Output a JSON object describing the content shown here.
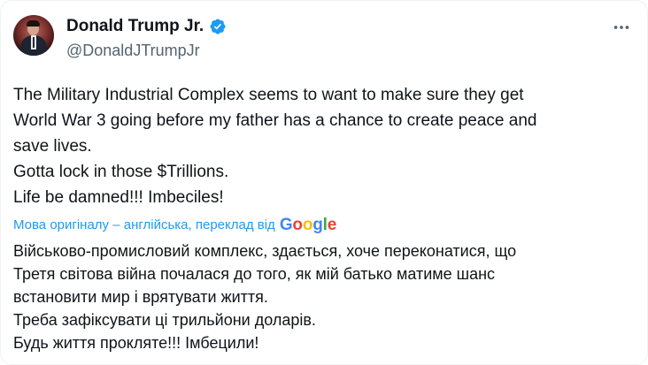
{
  "post": {
    "author": {
      "display_name": "Donald Trump Jr.",
      "handle": "@DonaldJTrumpJr",
      "verified": true
    },
    "original_text_lines": [
      "The Military Industrial Complex seems to want to make sure they get",
      "World War 3 going before my father has a chance to create peace and",
      "save lives.",
      "Gotta lock in those $Trillions.",
      "Life be damned!!! Imbeciles!"
    ],
    "translation": {
      "label": "Мова оригіналу – англійська, переклад від",
      "provider": "Google",
      "provider_letters": [
        "G",
        "o",
        "o",
        "g",
        "l",
        "e"
      ],
      "text_lines": [
        "Військово-промисловий комплекс, здається, хоче переконатися, що",
        "Третя світова війна почалася до того, як мій батько матиме шанс",
        "встановити мир і врятувати життя.",
        "Треба зафіксувати ці трильйони доларів.",
        "Будь життя прокляте!!! Імбецили!"
      ]
    }
  },
  "icons": {
    "avatar": "avatar",
    "verified": "verified-badge-icon",
    "more": "more-options-icon"
  },
  "colors": {
    "text": "#0f1419",
    "secondary": "#536471",
    "accent": "#1d9bf0",
    "google_blue": "#4285f4",
    "google_red": "#ea4335",
    "google_yellow": "#fbbc05",
    "google_green": "#34a853"
  }
}
